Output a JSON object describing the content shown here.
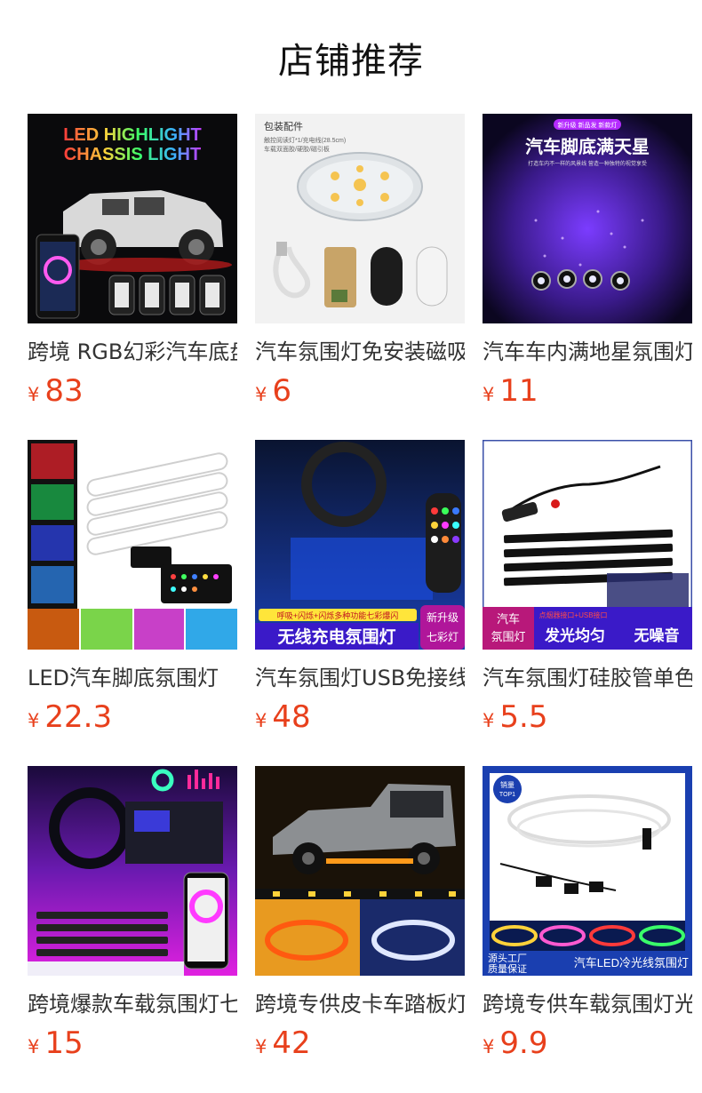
{
  "page": {
    "title": "店铺推荐"
  },
  "currency_symbol": "¥",
  "products": [
    {
      "name": "跨境 RGB幻彩汽车底盘灯",
      "price": "83",
      "image_text": [
        "LED HIGHLIGHT",
        "CHASSIS LIGHT"
      ]
    },
    {
      "name": "汽车氛围灯免安装磁吸",
      "price": "6",
      "image_text": [
        "包装配件",
        "触控阅读灯*1/充电线(28.5cm)",
        "车载双面胶/硬胶/磁引板"
      ]
    },
    {
      "name": "汽车车内满地星氛围灯",
      "price": "11",
      "image_text": [
        "新升级 新品发 新款灯",
        "汽车脚底满天星",
        "打造车内不一样的风景线 营造一种独特的视觉享受"
      ]
    },
    {
      "name": "LED汽车脚底氛围灯",
      "price": "22.3",
      "image_text": []
    },
    {
      "name": "汽车氛围灯USB免接线",
      "price": "48",
      "image_text": [
        "呼吸+闪烁+闪烁多种功能七彩爆闪",
        "无线充电氛围灯",
        "新升级",
        "七彩灯"
      ]
    },
    {
      "name": "汽车氛围灯硅胶管单色",
      "price": "5.5",
      "image_text": [
        "汽车",
        "氛围灯",
        "点烟器接口+USB接口",
        "发光均匀",
        "无噪音"
      ]
    },
    {
      "name": "跨境爆款车载氛围灯七彩",
      "price": "15",
      "image_text": []
    },
    {
      "name": "跨境专供皮卡车踏板灯",
      "price": "42",
      "image_text": []
    },
    {
      "name": "跨境专供车载氛围灯光纤",
      "price": "9.9",
      "image_text": [
        "销量",
        "TOP1",
        "源头工厂",
        "质量保证",
        "汽车LED冷光线氛围灯"
      ]
    }
  ],
  "colors": {
    "price": "#e8401c",
    "title": "#111111"
  }
}
